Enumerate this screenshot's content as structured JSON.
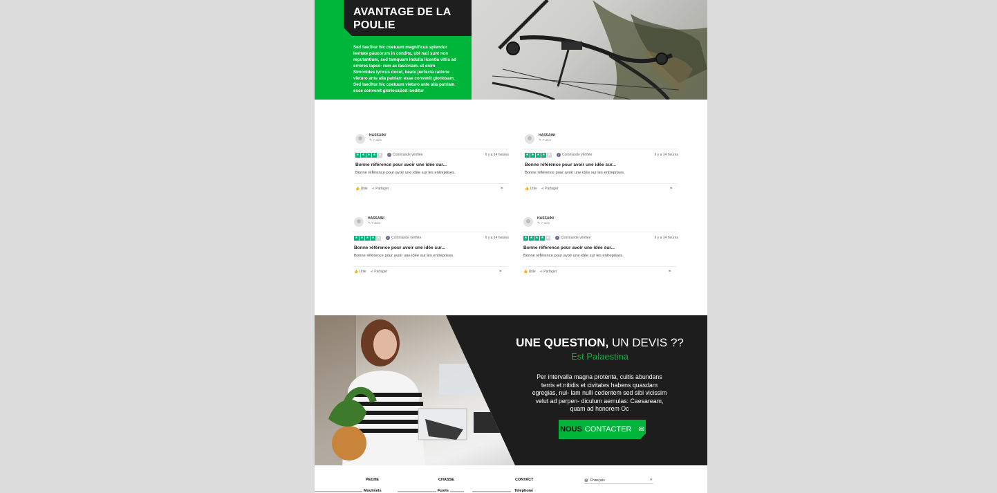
{
  "hero": {
    "title": "AVANTAGE DE LA POULIE",
    "text": "Sed laeditur hic coetuum magnificus splendor levitate paucorum in condita, ubi nati sunt non reputantium, sed tamquam indulta licentia vitiis ad errores lapso- rum ac lasciviam. ut enim Simonides lyricus docet, beate perfecta ratione vieturo ante alia patriam esse convenit gloriosam. Sed laeditur hic coetuum vieturo ante alia patriam esse convenit gloriosaSed laeditur"
  },
  "reviews": [
    {
      "name": "HASSAINI",
      "count": "7 avis",
      "verified": "Commande vérifiée",
      "time": "Il y a 14 heures",
      "title": "Bonne référence pour avoir une idée sur...",
      "body": "Bonne référence pour avoir une idée sur les entreprises.",
      "useful": "Utile",
      "share": "Partager",
      "stars": 4
    },
    {
      "name": "HASSAINI",
      "count": "7 avis",
      "verified": "Commande vérifiée",
      "time": "Il y a 14 heures",
      "title": "Bonne référence pour avoir une idée sur...",
      "body": "Bonne référence pour avoir une idée sur les entreprises.",
      "useful": "Utile",
      "share": "Partager",
      "stars": 4
    },
    {
      "name": "HASSAINI",
      "count": "7 avis",
      "verified": "Commande vérifiée",
      "time": "Il y a 14 heures",
      "title": "Bonne référence pour avoir une idée sur...",
      "body": "Bonne référence pour avoir une idée sur les entreprises.",
      "useful": "Utile",
      "share": "Partager",
      "stars": 4
    },
    {
      "name": "HASSAINI",
      "count": "7 avis",
      "verified": "Commande vérifiée",
      "time": "Il y a 14 heures",
      "title": "Bonne référence pour avoir une idée sur...",
      "body": "Bonne référence pour avoir une idée sur les entreprises.",
      "useful": "Utile",
      "share": "Partager",
      "stars": 4
    }
  ],
  "contact": {
    "title_bold": "UNE QUESTION,",
    "title_light": " UN DEVIS ??",
    "subtitle": "Est Palaestina",
    "text": "Per intervalla magna protenta, cultis abundans terris et nitidis et civitates habens quasdam egregias, nul- lam nulli cedentem sed sibi vicissim velut ad perpen- diculum aemulas: Caesaream, quam ad honorem Oc",
    "button_bold": "NOUS",
    "button_label": "CONTACTER"
  },
  "footer": {
    "columns": [
      {
        "title": "PECHE",
        "link": "Moulinets"
      },
      {
        "title": "CHASSE",
        "link": "Fusils"
      },
      {
        "title": "CONTACT",
        "link": "Telephone"
      }
    ],
    "language": "Français"
  },
  "colors": {
    "accent": "#00b63a",
    "dark": "#1d1d1d",
    "star": "#00b67a"
  }
}
